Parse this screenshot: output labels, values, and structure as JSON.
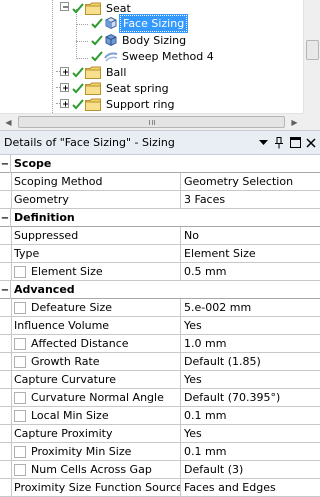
{
  "tree": {
    "items": [
      {
        "label": "Seat",
        "icon": "folder-icon",
        "checked": true,
        "expanded": true
      },
      {
        "label": "Face Sizing",
        "icon": "face-sizing-icon",
        "checked": true,
        "selected": true
      },
      {
        "label": "Body Sizing",
        "icon": "body-sizing-icon",
        "checked": true
      },
      {
        "label": "Sweep Method 4",
        "icon": "sweep-method-icon",
        "checked": true
      },
      {
        "label": "Ball",
        "icon": "folder-icon",
        "checked": true,
        "expanded": false
      },
      {
        "label": "Seat spring",
        "icon": "folder-icon",
        "checked": true,
        "expanded": false
      },
      {
        "label": "Support ring",
        "icon": "folder-icon",
        "checked": true,
        "expanded": false
      }
    ]
  },
  "details": {
    "title": "Details of \"Face Sizing\" - Sizing",
    "buttons": [
      "dropdown-icon",
      "pin-icon",
      "maximize-icon",
      "close-icon"
    ]
  },
  "grid": {
    "categories": {
      "scope": "Scope",
      "definition": "Definition",
      "advanced": "Advanced"
    },
    "rows": {
      "scoping_method": {
        "name": "Scoping Method",
        "value": "Geometry Selection"
      },
      "geometry": {
        "name": "Geometry",
        "value": "3 Faces"
      },
      "suppressed": {
        "name": "Suppressed",
        "value": "No"
      },
      "type": {
        "name": "Type",
        "value": "Element Size"
      },
      "element_size": {
        "name": "Element Size",
        "value": "0.5 mm"
      },
      "defeature_size": {
        "name": "Defeature Size",
        "value": "5.e-002 mm"
      },
      "influence_volume": {
        "name": "Influence Volume",
        "value": "Yes"
      },
      "affected_distance": {
        "name": "Affected Distance",
        "value": "1.0 mm"
      },
      "growth_rate": {
        "name": "Growth Rate",
        "value": "Default (1.85)"
      },
      "capture_curvature": {
        "name": "Capture Curvature",
        "value": "Yes"
      },
      "curvature_normal_angle": {
        "name": "Curvature Normal Angle",
        "value": "Default (70.395°)"
      },
      "local_min_size": {
        "name": "Local Min Size",
        "value": "0.1 mm"
      },
      "capture_proximity": {
        "name": "Capture Proximity",
        "value": "Yes"
      },
      "proximity_min_size": {
        "name": "Proximity Min Size",
        "value": "0.1 mm"
      },
      "num_cells_across_gap": {
        "name": "Num Cells Across Gap",
        "value": "Default (3)"
      },
      "proximity_size_function_sources": {
        "name": "Proximity Size Function Sources",
        "value": "Faces and Edges"
      }
    }
  },
  "colors": {
    "selection": "#3399ff",
    "check_green": "#2e9a2e",
    "folder_yellow": "#f2d06b",
    "header_bg": "#e9eef5"
  }
}
